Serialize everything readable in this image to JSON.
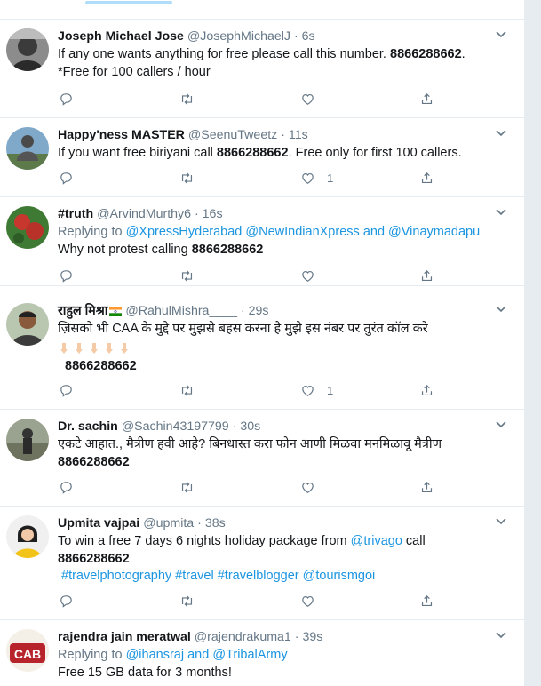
{
  "tweets": [
    {
      "name": "Joseph Michael Jose",
      "handle": "@JosephMichaelJ",
      "time": "6s",
      "text_before": "If any one wants anything for free please call this number. ",
      "number": "8866288662",
      "text_after": ".",
      "line2": "*Free for 100 callers / hour",
      "likes": ""
    },
    {
      "name": "Happy'ness MASTER",
      "handle": "@SeenuTweetz",
      "time": "11s",
      "text_before": "If you want free biriyani call ",
      "number": "8866288662",
      "text_after": ". Free only for first 100 callers.",
      "likes": "1"
    },
    {
      "name": "#truth",
      "handle": "@ArvindMurthy6",
      "time": "16s",
      "replying_label": "Replying to",
      "reply_a": "@XpressHyderabad",
      "reply_b": "@NewIndianXpress",
      "reply_and": "and",
      "reply_c": "@Vinaymadapu",
      "text_before": "Why not protest calling ",
      "number": "8866288662",
      "likes": ""
    },
    {
      "name": "राहुल मिश्रा",
      "handle": "@RahulMishra____",
      "time": "29s",
      "text": "ज़िसको भी CAA के मुद्दे पर मुझसे बहस करना है मुझे इस नंबर पर तुरंत कॉल करे",
      "number": "8866288662",
      "likes": "1"
    },
    {
      "name": "Dr. sachin",
      "handle": "@Sachin43197799",
      "time": "30s",
      "text": "एकटे आहात., मैत्रीण हवी आहे? बिनधास्त करा फोन आणी मिळवा मनमिळावू मैत्रीण",
      "number": "8866288662",
      "likes": ""
    },
    {
      "name": "Upmita vajpai",
      "handle": "@upmita",
      "time": "38s",
      "text_before": "To win a free 7 days 6 nights holiday package from ",
      "mention": "@trivago",
      "text_after": " call",
      "number": "8866288662",
      "hashtags": "#travelphotography #travel #travelblogger @tourismgoi",
      "likes": ""
    },
    {
      "name": "rajendra jain meratwal",
      "handle": "@rajendrakuma1",
      "time": "39s",
      "replying_label": "Replying to",
      "reply_a": "@ihansraj",
      "reply_and": "and",
      "reply_b": "@TribalArmy",
      "text": "Free 15 GB data for 3 months!",
      "avatar_text": "CAB",
      "likes": ""
    }
  ],
  "separator": "·",
  "icons": [
    "reply-icon",
    "retweet-icon",
    "like-icon",
    "share-icon",
    "chevron-down-icon"
  ],
  "colors": {
    "link": "#1b95e0",
    "muted": "#657786",
    "text": "#14171a",
    "border": "#e6ecf0"
  }
}
